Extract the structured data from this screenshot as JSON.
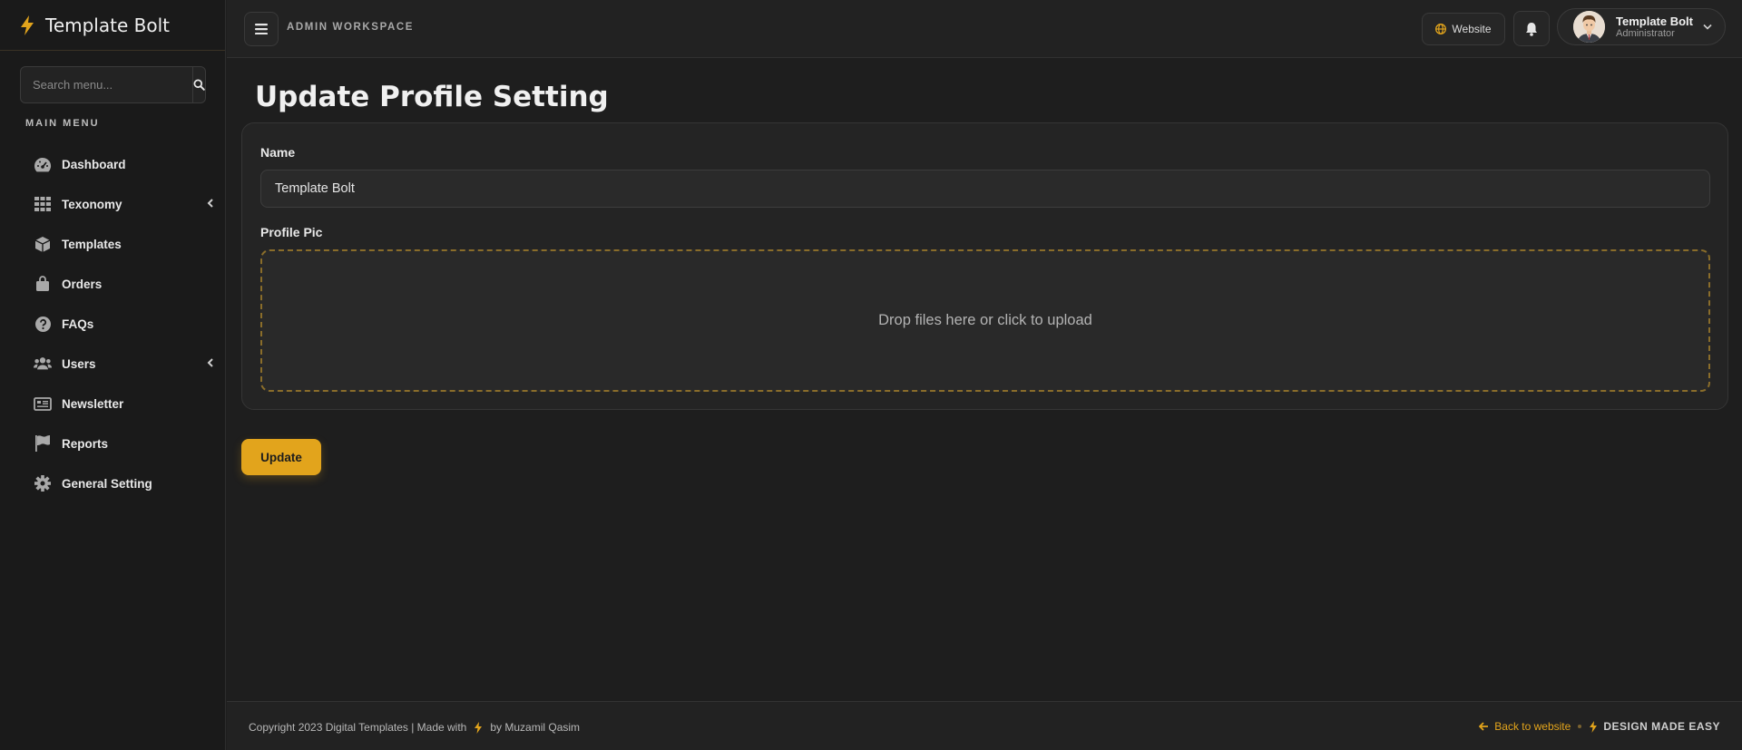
{
  "sidebar": {
    "brand": "Template Bolt",
    "search_placeholder": "Search menu...",
    "menu_heading": "MAIN MENU",
    "items": [
      {
        "label": "Dashboard",
        "icon": "dashboard-icon",
        "has_submenu": false
      },
      {
        "label": "Texonomy",
        "icon": "grid-icon",
        "has_submenu": true
      },
      {
        "label": "Templates",
        "icon": "box-icon",
        "has_submenu": false
      },
      {
        "label": "Orders",
        "icon": "shopping-bag-icon",
        "has_submenu": false
      },
      {
        "label": "FAQs",
        "icon": "question-circle-icon",
        "has_submenu": false
      },
      {
        "label": "Users",
        "icon": "users-icon",
        "has_submenu": true
      },
      {
        "label": "Newsletter",
        "icon": "newspaper-icon",
        "has_submenu": false
      },
      {
        "label": "Reports",
        "icon": "flag-icon",
        "has_submenu": false
      },
      {
        "label": "General Setting",
        "icon": "gear-icon",
        "has_submenu": false
      }
    ]
  },
  "topbar": {
    "workspace_label": "ADMIN WORKSPACE",
    "website_label": "Website",
    "user": {
      "name": "Template Bolt",
      "role": "Administrator"
    }
  },
  "main": {
    "title": "Update Profile Setting",
    "name_label": "Name",
    "name_value": "Template Bolt",
    "pic_label": "Profile Pic",
    "dropzone_text": "Drop files here or click to upload",
    "update_label": "Update"
  },
  "footer": {
    "copyright": "Copyright 2023 Digital Templates | Made with",
    "author": "by Muzamil Qasim",
    "back_link": "Back to website",
    "tagline": "DESIGN MADE EASY"
  },
  "colors": {
    "accent": "#e2a41c",
    "background": "#1e1e1e",
    "sidebar": "#1a1a1a",
    "card": "#242424"
  }
}
